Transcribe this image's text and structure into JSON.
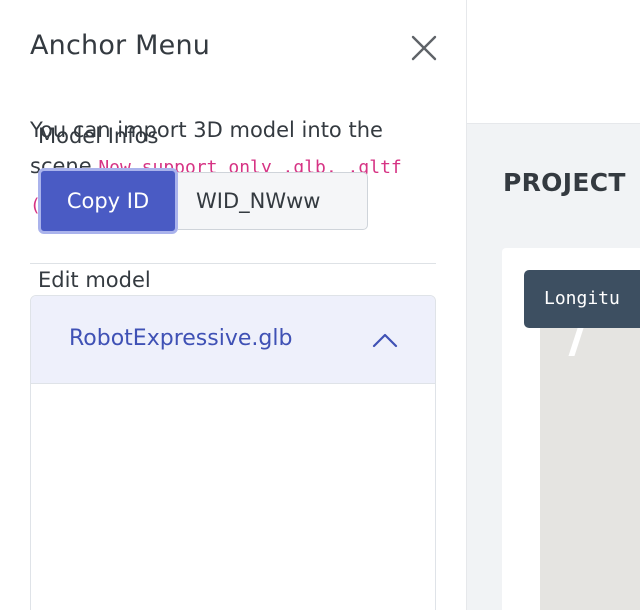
{
  "background": {
    "section_heading": "PROJECT",
    "tooltip_text": "Longitu"
  },
  "panel": {
    "title": "Anchor Menu",
    "description_text": "You can import 3D model into the scene ",
    "description_code": "Now support only .glb, .gltf (zip), and .USDZ",
    "model": {
      "name": "RobotExpressive.glb",
      "expanded": true,
      "infos_label": "Model Infos",
      "copy_button_label": "Copy ID",
      "id_value": "WID_NWww",
      "edit_label": "Edit model"
    }
  },
  "colors": {
    "accent": "#4a5bc4",
    "accent_text": "#3f51b5",
    "code": "#d63384",
    "header_bg": "#eef0fb",
    "tooltip_bg": "#3d4f61"
  },
  "icons": {
    "close": "close-icon",
    "collapse": "chevron-up-icon"
  }
}
